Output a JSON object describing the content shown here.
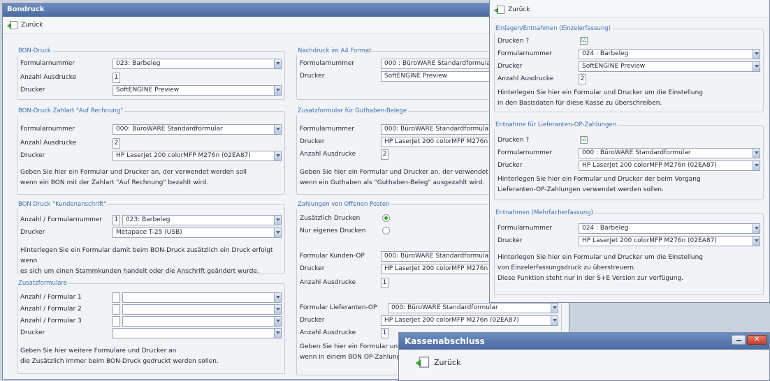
{
  "main": {
    "title": "Bondruck",
    "back": "Zurück",
    "bon": {
      "title": "BON-Druck",
      "form_label": "Formularnummer",
      "form": "023: Barbeleg",
      "count_label": "Anzahl Ausdrucke",
      "count": "1",
      "printer_label": "Drucker",
      "printer": "SoftENGINE Preview"
    },
    "rech": {
      "title": "BON-Druck Zahlart \"Auf Rechnung\"",
      "form_label": "Formularnummer",
      "form": "000: BüroWARE Standardformular",
      "count_label": "Anzahl Ausdrucke",
      "count": "2",
      "printer_label": "Drucker",
      "printer": "HP LaserJet 200 colorMFP M276n (02EA87)",
      "desc1": "Geben Sie hier ein Formular und Drucker an, der verwendet werden soll",
      "desc2": "wenn ein BON mit der Zahlart \"Auf Rechnung\" bezahlt wird."
    },
    "kunde": {
      "title": "BON Druck \"Kundenanschrift\"",
      "form_label": "Anzahl / Formularnummer",
      "count": "1",
      "form": "023: Barbeleg",
      "printer_label": "Drucker",
      "printer": "Metapace T-25 (USB)",
      "desc1": "Hinterlegen Sie ein Formular damit beim BON-Druck zusätzlich ein Druck erfolgt wenn",
      "desc2": "es sich um einen Stammkunden handelt oder die Anschrift geändert wurde."
    },
    "zusatz": {
      "title": "Zusatzformulare",
      "f1": "Anzahl / Formular 1",
      "f2": "Anzahl / Formular 2",
      "f3": "Anzahl / Formular 3",
      "printer_label": "Drucker",
      "desc1": "Geben Sie hier weitere Formulare und Drucker an",
      "desc2": "die Zusätzlich immer beim BON-Druck gedruckt werden sollen."
    },
    "a4": {
      "title": "Nachdruck im A4 Format",
      "form_label": "Formularnummer",
      "form": "000 : BüroWARE Standardformular",
      "printer_label": "Drucker",
      "printer": "SoftENGINE Preview"
    },
    "guth": {
      "title": "Zusatzformular für Guthaben-Belege",
      "form_label": "Formularnummer",
      "form": "000: BüroWARE Standardformular",
      "printer_label": "Drucker",
      "printer": "HP LaserJet 200 colorMFP M276n (02",
      "count_label": "Anzahl Ausdrucke",
      "count": "2",
      "desc1": "Geben Sie hier ein Formular und Drucker an, der verwendet werd",
      "desc2": "wenn ein Guthaben als \"Guthaben-Beleg\" ausgezahlt wird."
    },
    "op": {
      "title": "Zahlungen von Offenen Posten",
      "r1": "Zusätzlich Drucken",
      "r2": "Nur eigenes Drucken",
      "kform_label": "Formular Kunden-OP",
      "kform": "000: BüroWARE Standardformular",
      "printer_label": "Drucker",
      "kprinter": "HP LaserJet 200 colorMFP M276n (0",
      "count_label": "Anzahl Ausdrucke",
      "kcount": "1",
      "lform_label": "Formular Lieferanten-OP",
      "lform": "000: BüroWARE Standardformular",
      "lprinter": "HP LaserJet 200 colorMFP M276n (02EA87)",
      "lcount": "1",
      "desc1": "Geben Sie hier ein Formular und D",
      "desc2": "wenn in einem BON OP-Zahlunge"
    }
  },
  "right": {
    "back": "Zurück",
    "einl": {
      "title": "Einlagen/Entnahmen (Einzelerfassung)",
      "print_label": "Drucken ?",
      "check": "☑",
      "form_label": "Formularnummer",
      "form": "024 : Barbeleg",
      "printer_label": "Drucker",
      "printer": "SoftENGINE Preview",
      "count_label": "Anzahl Ausdrucke",
      "count": "2",
      "desc1": "Hinterlegen Sie hier ein Formular und Drucker um die Einstellung",
      "desc2": "in den Basisdaten für diese Kasse zu überschreiben."
    },
    "lief": {
      "title": "Entnahme für Lieferanten-OP-Zahlungen",
      "print_label": "Drucken ?",
      "check": "☑",
      "form_label": "Formularnummer",
      "form": "000 : BüroWARE Standardformular",
      "printer_label": "Drucker",
      "printer": "HP LaserJet 200 colorMFP M276n (02EA87)",
      "desc1": "Hinterlegen Sie hier ein Formular und Drucker der beim Vorgang",
      "desc2": "Lieferanten-OP-Zahlungen verwendet werden sollen."
    },
    "mehr": {
      "title": "Entnahmen (Mehrfacherfassung)",
      "form_label": "Formularnummer",
      "form": "024 : Barbeleg",
      "printer_label": "Drucker",
      "printer": "HP LaserJet 200 colorMFP M276n (02EA87)",
      "desc1": "Hinterlegen Sie hier ein Formular und Drucker um die Einstellung",
      "desc2": "von Einzelerfassungsdruck zu überstreuern.",
      "desc3": "Diese Funktion steht nur in der S+E Version zur verfügung."
    }
  },
  "kasse": {
    "title": "Kassenabschluss",
    "back": "Zurück"
  }
}
